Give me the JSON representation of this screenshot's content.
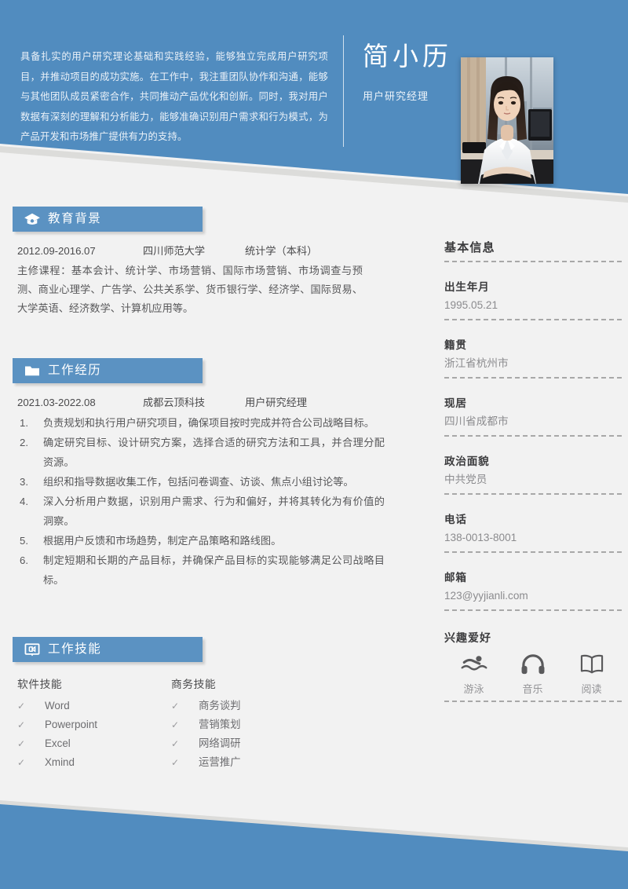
{
  "header": {
    "summary": "具备扎实的用户研究理论基础和实践经验，能够独立完成用户研究项目，并推动项目的成功实施。在工作中，我注重团队协作和沟通，能够与其他团队成员紧密合作，共同推动产品优化和创新。同时，我对用户数据有深刻的理解和分析能力，能够准确识别用户需求和行为模式，为产品开发和市场推广提供有力的支持。",
    "name": "简小历",
    "job_title": "用户研究经理",
    "photo_alt": "portrait-photo"
  },
  "colors": {
    "brand_blue": "#518cbf",
    "section_bar_blue": "#5b92c2",
    "page_bg": "#f2f2f2",
    "body_text": "#58585a",
    "label_text": "#3b3b3d",
    "muted_text": "#8b8b8e",
    "dashed_rule": "#a8a8a8"
  },
  "sections": {
    "education": {
      "icon": "graduation-cap-icon",
      "title": "教育背景",
      "entry": {
        "date": "2012.09-2016.07",
        "school": "四川师范大学",
        "major": "统计学（本科）"
      },
      "courses": "主修课程：基本会计、统计学、市场营销、国际市场营销、市场调查与预测、商业心理学、广告学、公共关系学、货币银行学、经济学、国际贸易、大学英语、经济数学、计算机应用等。"
    },
    "work": {
      "icon": "folder-icon",
      "title": "工作经历",
      "entry": {
        "date": "2021.03-2022.08",
        "company": "成都云顶科技",
        "role": "用户研究经理"
      },
      "duties": [
        "负责规划和执行用户研究项目，确保项目按时完成并符合公司战略目标。",
        "确定研究目标、设计研究方案，选择合适的研究方法和工具，并合理分配资源。",
        "组织和指导数据收集工作，包括问卷调查、访谈、焦点小组讨论等。",
        "深入分析用户数据，识别用户需求、行为和偏好，并将其转化为有价值的洞察。",
        "根据用户反馈和市场趋势，制定产品策略和路线图。",
        "制定短期和长期的产品目标，并确保产品目标的实现能够满足公司战略目标。"
      ]
    },
    "skills": {
      "icon": "presentation-icon",
      "title": "工作技能",
      "check_glyph": "✓",
      "columns": [
        {
          "title": "软件技能",
          "items": [
            "Word",
            "Powerpoint",
            "Excel",
            "Xmind"
          ]
        },
        {
          "title": "商务技能",
          "items": [
            "商务谈判",
            "营销策划",
            "网络调研",
            "运营推广"
          ]
        }
      ]
    }
  },
  "sidebar": {
    "title": "基本信息",
    "fields": [
      {
        "label": "出生年月",
        "value": "1995.05.21"
      },
      {
        "label": "籍贯",
        "value": "浙江省杭州市"
      },
      {
        "label": "现居",
        "value": "四川省成都市"
      },
      {
        "label": "政治面貌",
        "value": "中共党员"
      },
      {
        "label": "电话",
        "value": "138-0013-8001"
      },
      {
        "label": "邮箱",
        "value": "123@yyjianli.com"
      }
    ],
    "hobbies_title": "兴趣爱好",
    "hobbies": [
      {
        "icon": "swimming-icon",
        "label": "游泳"
      },
      {
        "icon": "headphones-icon",
        "label": "音乐"
      },
      {
        "icon": "open-book-icon",
        "label": "阅读"
      }
    ]
  }
}
